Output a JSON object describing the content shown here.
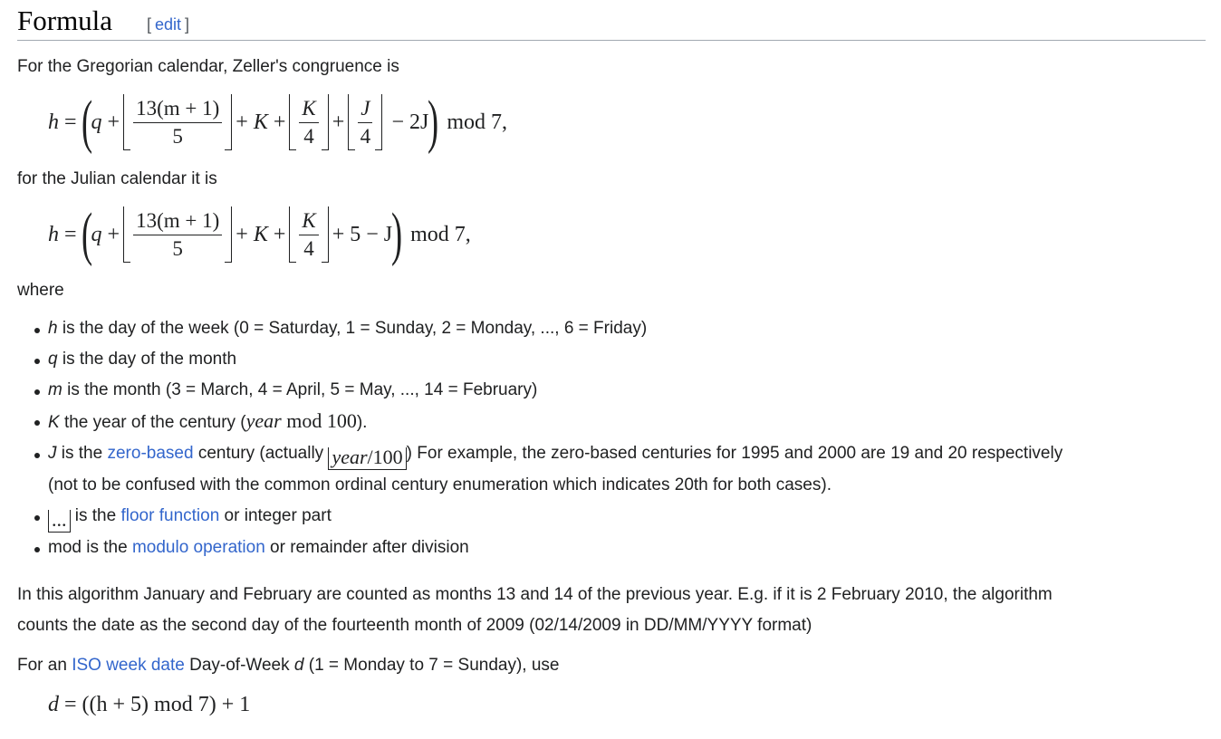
{
  "heading": {
    "title": "Formula",
    "edit_open": "[",
    "edit_label": "edit",
    "edit_close": "]"
  },
  "intro_gregorian": "For the Gregorian calendar, Zeller's congruence is",
  "intro_julian": "for the Julian calendar it is",
  "where": "where",
  "formula": {
    "h": "h",
    "eq": "=",
    "q": "q",
    "plus": "+",
    "K": "K",
    "J": "J",
    "num1": "13(m + 1)",
    "den1": "5",
    "four": "4",
    "minus2J": "− 2J",
    "mod7": "mod 7,",
    "plus5minusJ": "+ 5 − J"
  },
  "definitions": [
    {
      "var": "h",
      "text": " is the day of the week (0 = Saturday, 1 = Sunday, 2 = Monday, ..., 6 = Friday)"
    },
    {
      "var": "q",
      "text": " is the day of the month"
    },
    {
      "var": "m",
      "text": " is the month (3 = March, 4 = April, 5 = May, ..., 14 = February)"
    },
    {
      "var": "K",
      "text_before": " the year of the century (",
      "math": "year",
      "math_mod": " mod 100",
      "text_after": ")."
    },
    {
      "var": "J",
      "text_before": " is the ",
      "link": "zero-based",
      "text_mid": " century (actually ",
      "math": "year",
      "math_rest": "/100",
      "text_after": ") For example, the zero-based centuries for 1995 and 2000 are 19 and 20 respectively",
      "text_line2": "(not to be confused with the common ordinal century enumeration which indicates 20th for both cases)."
    },
    {
      "math": "...",
      "text_before": " is the ",
      "link": "floor function",
      "text_after": " or integer part"
    },
    {
      "var_plain": "mod",
      "text_before": " is the ",
      "link": "modulo operation",
      "text_after": " or remainder after division"
    }
  ],
  "para_algorithm_line1": "In this algorithm January and February are counted as months 13 and 14 of the previous year. E.g. if it is 2 February 2010, the algorithm",
  "para_algorithm_line2": "counts the date as the second day of the fourteenth month of 2009 (02/14/2009 in DD/MM/YYYY format)",
  "iso": {
    "before": "For an ",
    "link": "ISO week date",
    "middle": " Day-of-Week ",
    "var": "d",
    "after": " (1 = Monday to 7 = Sunday), use"
  },
  "iso_formula": {
    "d": "d",
    "rest": "= ((h + 5) mod 7) + 1"
  },
  "colors": {
    "link": "#3366cc",
    "text": "#202122",
    "rule": "#a2a9b1"
  }
}
